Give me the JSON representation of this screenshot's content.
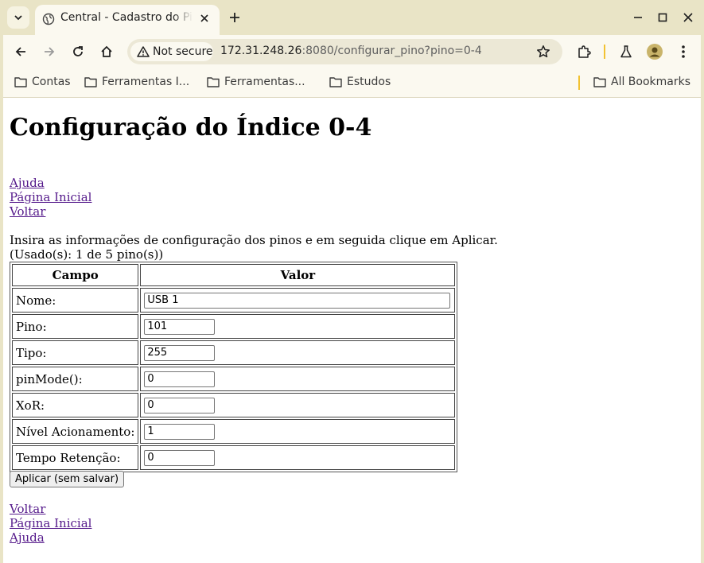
{
  "browser": {
    "tab_title": "Central - Cadastro do Pinos",
    "new_tab_symbol": "+",
    "security_label": "Not secure",
    "url_host": "172.31.248.26",
    "url_rest": ":8080/configurar_pino?pino=0-4",
    "bookmarks": [
      "Contas",
      "Ferramentas I...",
      "Ferramentas...",
      "Estudos"
    ],
    "all_bookmarks": "All Bookmarks",
    "icons": [
      "tab-search-icon",
      "globe-icon",
      "close-icon",
      "plus-icon",
      "minimize-icon",
      "maximize-icon",
      "back-icon",
      "forward-icon",
      "reload-icon",
      "home-icon",
      "warning-icon",
      "star-icon",
      "extensions-icon",
      "labs-icon",
      "profile-icon",
      "menu-icon",
      "folder-icon"
    ]
  },
  "page": {
    "title": "Configuração do Índice 0-4",
    "top_links": [
      "Ajuda",
      "Página Inicial",
      "Voltar"
    ],
    "instructions": "Insira as informações de configuração dos pinos e em seguida clique em Aplicar.",
    "usage": "(Usado(s): 1 de 5 pino(s))",
    "table": {
      "headers": [
        "Campo",
        "Valor"
      ],
      "rows": [
        {
          "label": "Nome:",
          "value": "USB 1"
        },
        {
          "label": "Pino:",
          "value": "101"
        },
        {
          "label": "Tipo:",
          "value": "255"
        },
        {
          "label": "pinMode():",
          "value": "0"
        },
        {
          "label": "XoR:",
          "value": "0"
        },
        {
          "label": "Nível Acionamento:",
          "value": "1"
        },
        {
          "label": "Tempo Retenção:",
          "value": "0"
        }
      ]
    },
    "apply_button": "Aplicar (sem salvar)",
    "bottom_links": [
      "Voltar",
      "Página Inicial",
      "Ajuda"
    ]
  }
}
